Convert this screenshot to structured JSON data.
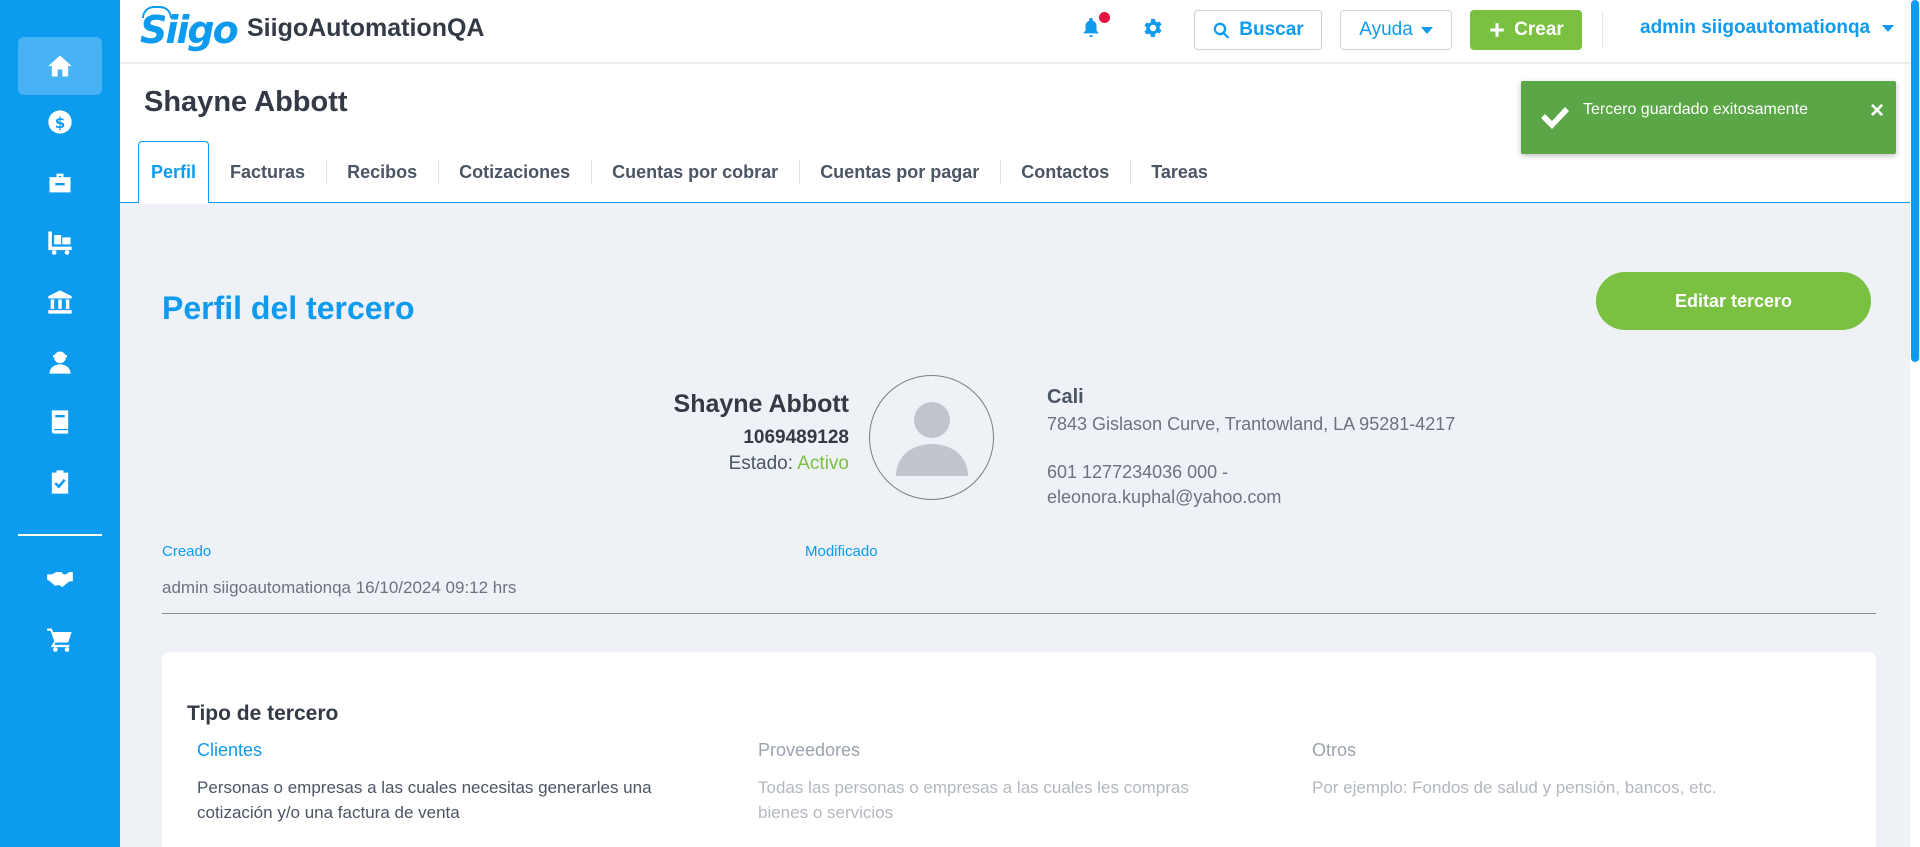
{
  "header": {
    "logo": "Siigo",
    "company": "SiigoAutomationQA",
    "search_label": "Buscar",
    "help_label": "Ayuda",
    "create_label": "Crear",
    "user": "admin siigoautomationqa"
  },
  "sidebar": {
    "items": [
      {
        "name": "home-icon",
        "active": true
      },
      {
        "name": "money-icon"
      },
      {
        "name": "briefcase-icon"
      },
      {
        "name": "inventory-icon"
      },
      {
        "name": "bank-icon"
      },
      {
        "name": "employee-icon"
      },
      {
        "name": "book-icon"
      },
      {
        "name": "clipboard-check-icon"
      },
      {
        "name": "handshake-icon"
      },
      {
        "name": "cart-icon"
      }
    ]
  },
  "page": {
    "title": "Shayne Abbott",
    "tabs": [
      {
        "label": "Perfil",
        "active": true
      },
      {
        "label": "Facturas"
      },
      {
        "label": "Recibos"
      },
      {
        "label": "Cotizaciones"
      },
      {
        "label": "Cuentas por cobrar"
      },
      {
        "label": "Cuentas por pagar"
      },
      {
        "label": "Contactos"
      },
      {
        "label": "Tareas"
      }
    ]
  },
  "toast": {
    "message": "Tercero guardado exitosamente",
    "close": "×"
  },
  "profile": {
    "section_title": "Perfil del tercero",
    "edit_label": "Editar tercero",
    "name": "Shayne Abbott",
    "id_number": "1069489128",
    "status_label": "Estado: ",
    "status_value": "Activo",
    "city": "Cali",
    "address": "7843 Gislason Curve, Trantowland, LA 95281-4217",
    "phone": "601 1277234036 000 -",
    "email": "eleonora.kuphal@yahoo.com"
  },
  "meta": {
    "created_label": "Creado",
    "modified_label": "Modificado",
    "created_value": "admin siigoautomationqa 16/10/2024 09:12 hrs"
  },
  "third_party_type": {
    "title": "Tipo de tercero",
    "options": [
      {
        "label": "Clientes",
        "desc": "Personas o empresas a las cuales necesitas generarles una cotización y/o una factura de venta"
      },
      {
        "label": "Proveedores",
        "desc": "Todas las personas o empresas a las cuales les compras bienes o servicios"
      },
      {
        "label": "Otros",
        "desc": "Por ejemplo: Fondos de salud y pensión, bancos, etc."
      }
    ]
  },
  "colors": {
    "primary": "#0d9bf0",
    "success": "#7ac142",
    "toast": "#5ba747",
    "notification": "#e5133f"
  }
}
